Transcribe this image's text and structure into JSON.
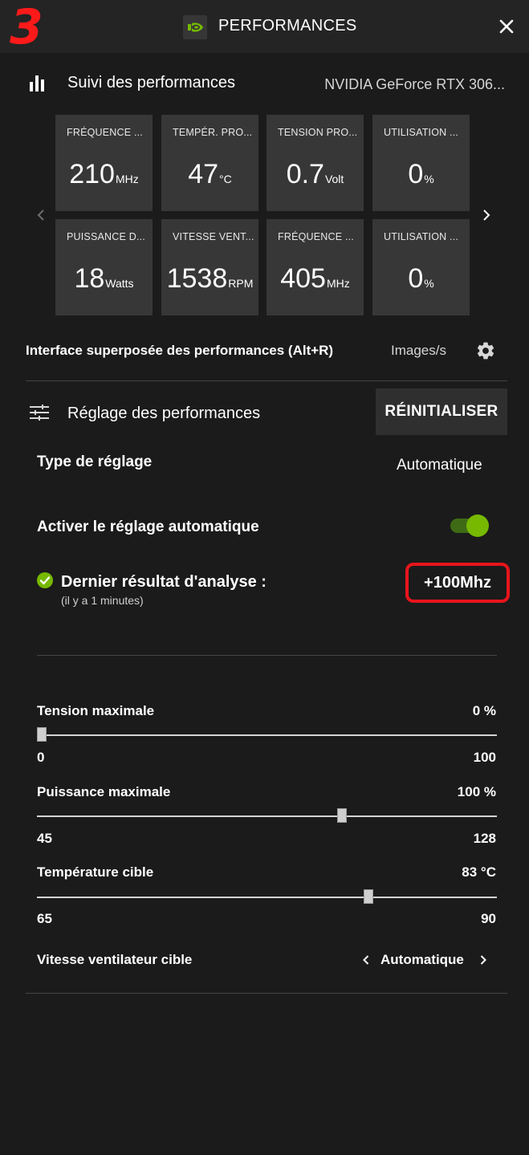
{
  "header": {
    "step_number": "3",
    "title": "PERFORMANCES"
  },
  "monitoring": {
    "title": "Suivi des performances",
    "gpu_name": "NVIDIA GeForce RTX 306...",
    "tiles": [
      {
        "label": "FRÉQUENCE ...",
        "value": "210",
        "unit": "MHz"
      },
      {
        "label": "TEMPÉR. PRO...",
        "value": "47",
        "unit": "°C"
      },
      {
        "label": "TENSION PRO...",
        "value": "0.7",
        "unit": "Volt"
      },
      {
        "label": "UTILISATION ...",
        "value": "0",
        "unit": "%"
      },
      {
        "label": "PUISSANCE D...",
        "value": "18",
        "unit": "Watts"
      },
      {
        "label": "VITESSE VENT...",
        "value": "1538",
        "unit": "RPM"
      },
      {
        "label": "FRÉQUENCE ...",
        "value": "405",
        "unit": "MHz"
      },
      {
        "label": "UTILISATION ...",
        "value": "0",
        "unit": "%"
      }
    ],
    "overlay_label": "Interface superposée des performances (Alt+R)",
    "overlay_value": "Images/s"
  },
  "tuning": {
    "title": "Réglage des performances",
    "reset_label": "RÉINITIALISER",
    "type_label": "Type de réglage",
    "type_value": "Automatique",
    "auto_label": "Activer le réglage automatique",
    "auto_enabled": true,
    "scan_label": "Dernier résultat d'analyse :",
    "scan_time": "(il y a 1 minutes)",
    "scan_value": "+100Mhz",
    "sliders": [
      {
        "label": "Tension maximale",
        "value_text": "0 %",
        "min": 0,
        "max": 100,
        "value": 0,
        "min_label": "0",
        "max_label": "100"
      },
      {
        "label": "Puissance maximale",
        "value_text": "100 %",
        "min": 45,
        "max": 128,
        "value": 100,
        "min_label": "45",
        "max_label": "128"
      },
      {
        "label": "Température cible",
        "value_text": "83 °C",
        "min": 65,
        "max": 90,
        "value": 83,
        "min_label": "65",
        "max_label": "90"
      }
    ],
    "fan_label": "Vitesse ventilateur cible",
    "fan_value": "Automatique"
  },
  "colors": {
    "accent": "#76b900",
    "highlight": "#e8141c",
    "step_number": "#ff1a1a"
  },
  "icons": {
    "logo": "nvidia-logo-icon",
    "close": "close-icon",
    "chart": "bar-chart-icon",
    "prev": "chevron-left-icon",
    "next": "chevron-right-icon",
    "settings": "gear-icon",
    "tuning": "sliders-icon",
    "check": "check-circle-icon"
  }
}
